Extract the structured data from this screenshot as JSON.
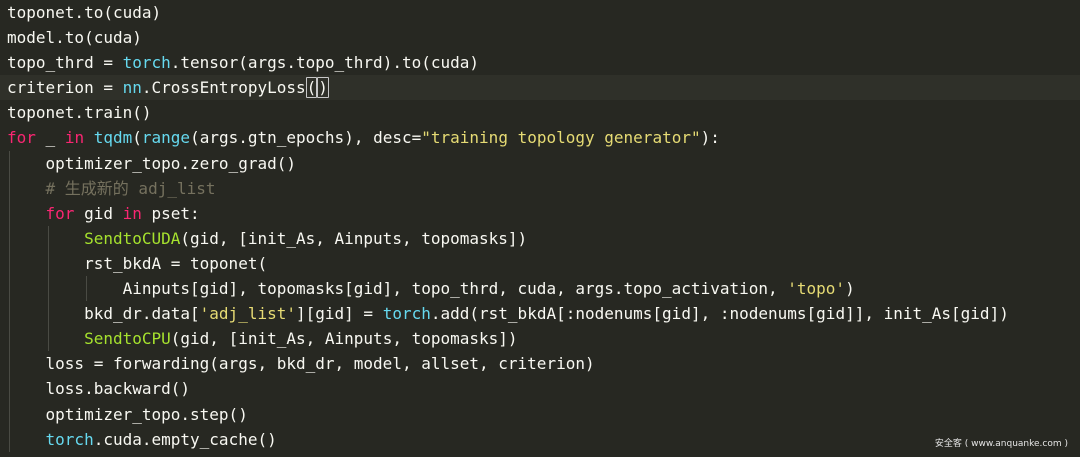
{
  "colors": {
    "background": "#272822",
    "default": "#f8f8f2",
    "builtin": "#66d9ef",
    "keyword": "#f92672",
    "string": "#e6db74",
    "comment": "#75715e",
    "special": "#a6e22e"
  },
  "editor": {
    "lines": [
      {
        "indent": 0,
        "tokens": [
          [
            "toponet.to(cuda)",
            "default"
          ]
        ]
      },
      {
        "indent": 0,
        "tokens": [
          [
            "model.to(cuda)",
            "default"
          ]
        ]
      },
      {
        "indent": 0,
        "tokens": [
          [
            "topo_thrd = ",
            "default"
          ],
          [
            "torch",
            "builtin"
          ],
          [
            ".tensor(args.topo_thrd).to(cuda)",
            "default"
          ]
        ]
      },
      {
        "indent": 0,
        "current": true,
        "tokens": [
          [
            "criterion = ",
            "default"
          ],
          [
            "nn",
            "builtin"
          ],
          [
            ".CrossEntropyLoss",
            "default"
          ],
          [
            "(",
            "bracket-match"
          ],
          [
            ")",
            "bracket-match"
          ]
        ]
      },
      {
        "indent": 0,
        "tokens": [
          [
            "toponet.train()",
            "default"
          ]
        ]
      },
      {
        "indent": 0,
        "tokens": [
          [
            "for",
            "keyword"
          ],
          [
            " _ ",
            "default"
          ],
          [
            "in",
            "keyword"
          ],
          [
            " ",
            "default"
          ],
          [
            "tqdm",
            "builtin"
          ],
          [
            "(",
            "default"
          ],
          [
            "range",
            "builtin"
          ],
          [
            "(args.gtn_epochs), desc=",
            "default"
          ],
          [
            "\"training topology generator\"",
            "string"
          ],
          [
            "):",
            "default"
          ]
        ]
      },
      {
        "indent": 1,
        "tokens": [
          [
            "optimizer_topo.zero_grad()",
            "default"
          ]
        ]
      },
      {
        "indent": 1,
        "tokens": [
          [
            "# 生成新的 adj_list",
            "comment"
          ]
        ]
      },
      {
        "indent": 1,
        "tokens": [
          [
            "for",
            "keyword"
          ],
          [
            " gid ",
            "default"
          ],
          [
            "in",
            "keyword"
          ],
          [
            " pset:",
            "default"
          ]
        ]
      },
      {
        "indent": 2,
        "tokens": [
          [
            "SendtoCUDA",
            "special"
          ],
          [
            "(gid, [init_As, Ainputs, topomasks])",
            "default"
          ]
        ]
      },
      {
        "indent": 2,
        "tokens": [
          [
            "rst_bkdA = toponet(",
            "default"
          ]
        ]
      },
      {
        "indent": 3,
        "tokens": [
          [
            "Ainputs[gid], topomasks[gid], topo_thrd, cuda, args.topo_activation, ",
            "default"
          ],
          [
            "'topo'",
            "string"
          ],
          [
            ")",
            "default"
          ]
        ]
      },
      {
        "indent": 2,
        "tokens": [
          [
            "bkd_dr.data[",
            "default"
          ],
          [
            "'adj_list'",
            "string"
          ],
          [
            "][gid] = ",
            "default"
          ],
          [
            "torch",
            "builtin"
          ],
          [
            ".add(rst_bkdA[:nodenums[gid], :nodenums[gid]], init_As[gid])",
            "default"
          ]
        ]
      },
      {
        "indent": 2,
        "tokens": [
          [
            "SendtoCPU",
            "special"
          ],
          [
            "(gid, [init_As, Ainputs, topomasks])",
            "default"
          ]
        ]
      },
      {
        "indent": 1,
        "tokens": [
          [
            "loss = forwarding(args, bkd_dr, model, allset, criterion)",
            "default"
          ]
        ]
      },
      {
        "indent": 1,
        "tokens": [
          [
            "loss.backward()",
            "default"
          ]
        ]
      },
      {
        "indent": 1,
        "tokens": [
          [
            "optimizer_topo.step()",
            "default"
          ]
        ]
      },
      {
        "indent": 1,
        "tokens": [
          [
            "torch",
            "builtin"
          ],
          [
            ".cuda.empty_cache()",
            "default"
          ]
        ]
      }
    ]
  },
  "watermark": "安全客 ( www.anquanke.com )"
}
